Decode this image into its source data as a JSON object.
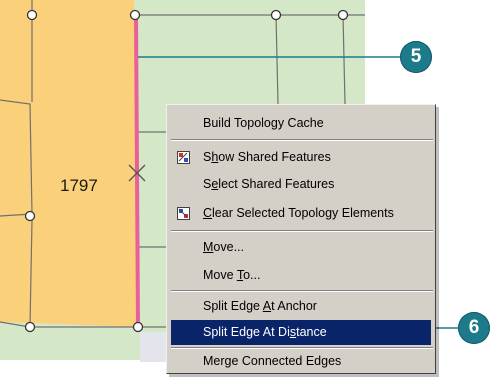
{
  "map": {
    "parcel_id": "1797",
    "colors": {
      "parcel_fill": "#fbd07a",
      "neighbor_fill": "#d4e8c8",
      "shared_edge": "#e8609a",
      "line": "#707070",
      "callout": "#1d7a8a"
    }
  },
  "callouts": [
    {
      "number": "5",
      "target": "shared-edge"
    },
    {
      "number": "6",
      "target": "split-edge-at-distance"
    }
  ],
  "context_menu": {
    "items": [
      {
        "label": "Build Topology Cache",
        "icon": null,
        "underline": null,
        "selected": false
      },
      {
        "label": "Show Shared Features",
        "icon": "shared-features-icon",
        "underline": "h",
        "selected": false
      },
      {
        "label": "Select Shared Features",
        "icon": null,
        "underline": "e",
        "selected": false
      },
      {
        "label": "Clear Selected Topology Elements",
        "icon": "clear-topology-icon",
        "underline": "C",
        "selected": false
      },
      {
        "label": "Move...",
        "icon": null,
        "underline": "M",
        "selected": false
      },
      {
        "label": "Move To...",
        "icon": null,
        "underline": "T",
        "selected": false
      },
      {
        "label": "Split Edge At Anchor",
        "icon": null,
        "underline": "A",
        "selected": false
      },
      {
        "label": "Split Edge At Distance",
        "icon": null,
        "underline": "s",
        "selected": true
      },
      {
        "label": "Merge Connected Edges",
        "icon": null,
        "underline": "g",
        "selected": false
      }
    ]
  }
}
